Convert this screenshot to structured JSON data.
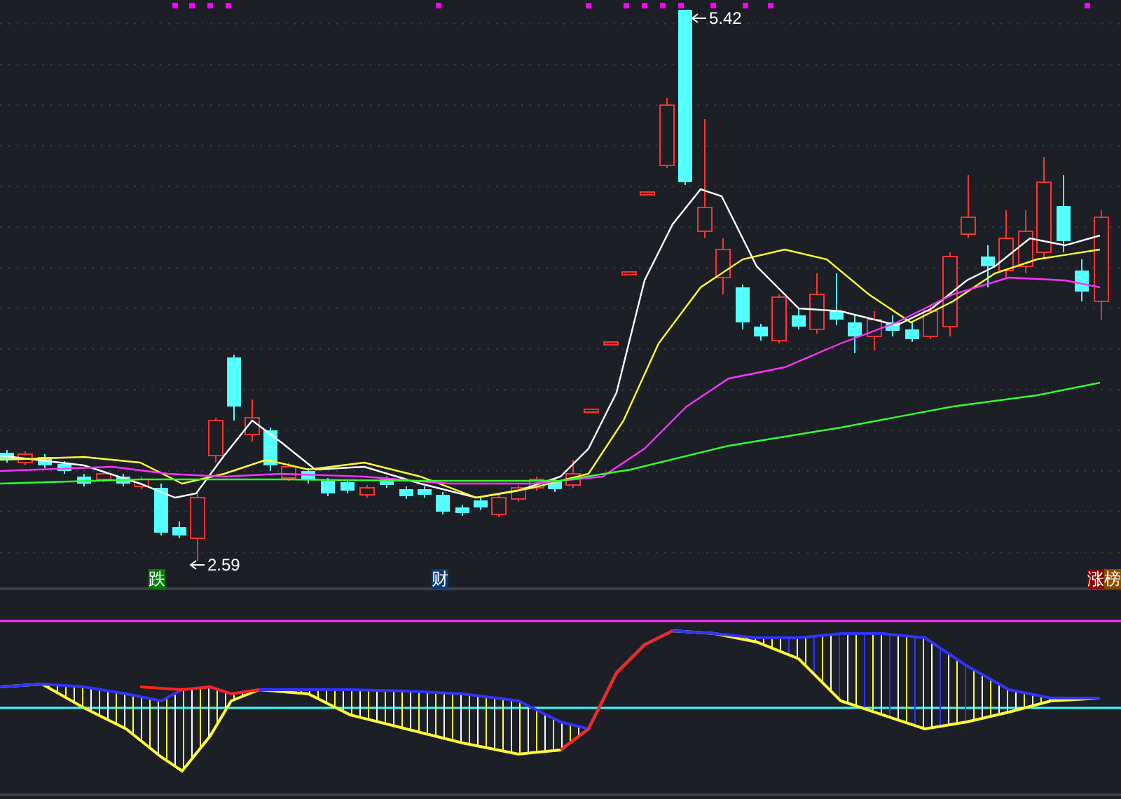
{
  "price_labels": [
    {
      "kind": "high",
      "text": "5.42"
    },
    {
      "kind": "low",
      "text": "2.59"
    }
  ],
  "tags": [
    {
      "text": "跌",
      "color": "#008000"
    },
    {
      "text": "财",
      "color": "#0b3b78"
    },
    {
      "text": "涨",
      "color": "#8b0000"
    },
    {
      "text": "榜",
      "color": "#8b4a00"
    }
  ]
}
